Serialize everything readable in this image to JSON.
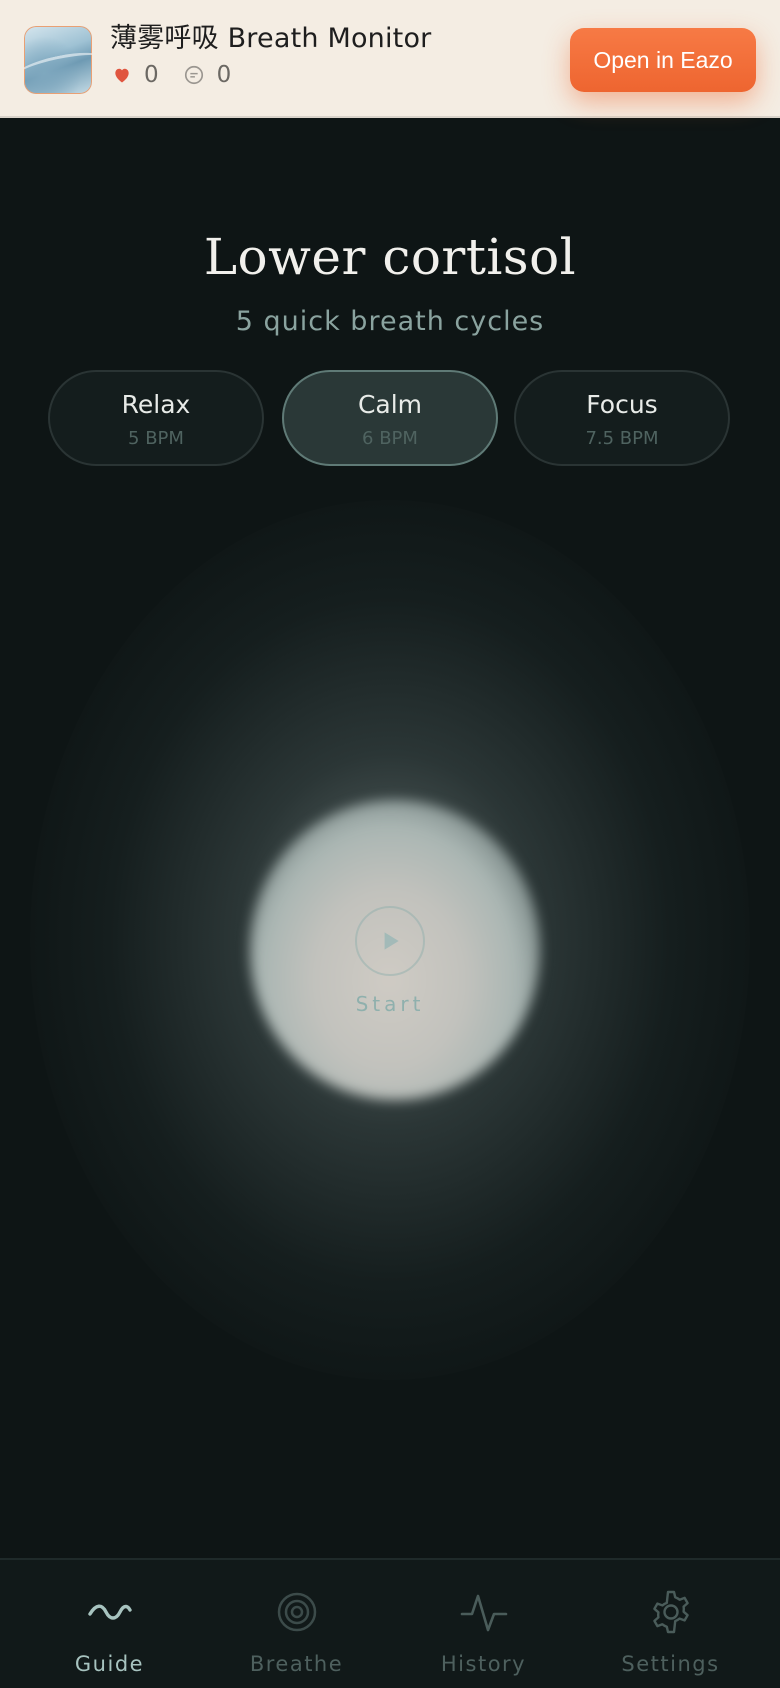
{
  "banner": {
    "app_title": "薄雾呼吸 Breath Monitor",
    "likes": "0",
    "comments": "0",
    "open_button": "Open in Eazo"
  },
  "main": {
    "headline": "Lower cortisol",
    "subline": "5 quick breath cycles",
    "modes": [
      {
        "name": "Relax",
        "bpm": "5 BPM",
        "active": false
      },
      {
        "name": "Calm",
        "bpm": "6 BPM",
        "active": true
      },
      {
        "name": "Focus",
        "bpm": "7.5 BPM",
        "active": false
      }
    ],
    "start_label": "Start"
  },
  "nav": {
    "items": [
      {
        "label": "Guide",
        "icon": "wave-icon",
        "active": true
      },
      {
        "label": "Breathe",
        "icon": "concentric-circles-icon",
        "active": false
      },
      {
        "label": "History",
        "icon": "pulse-icon",
        "active": false
      },
      {
        "label": "Settings",
        "icon": "gear-icon",
        "active": false
      }
    ]
  },
  "colors": {
    "background": "#0e1515",
    "banner_bg": "#f4ede3",
    "accent_orange": "#f0703a",
    "active_nav": "#a7c3bf"
  }
}
